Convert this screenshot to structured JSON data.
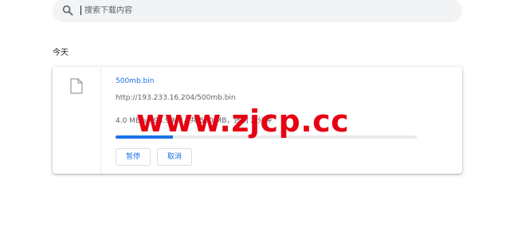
{
  "search": {
    "placeholder": "搜索下载内容",
    "icon": "search-icon"
  },
  "section": {
    "date_label": "今天"
  },
  "download": {
    "file_name": "500mb.bin",
    "url": "http://193.233.16.204/500mb.bin",
    "status": "4.0 MB/s - 93.9 MB，共 500 MB，还剩 2 分钟",
    "progress_fraction": 0.19,
    "pause_label": "暂停",
    "cancel_label": "取消",
    "file_icon": "file-icon"
  },
  "watermark": {
    "text": "www.zjcp.cc",
    "color": "#e60012"
  },
  "colors": {
    "accent": "#1a73e8",
    "search_bg": "#f1f3f4",
    "muted": "#5f6368"
  }
}
